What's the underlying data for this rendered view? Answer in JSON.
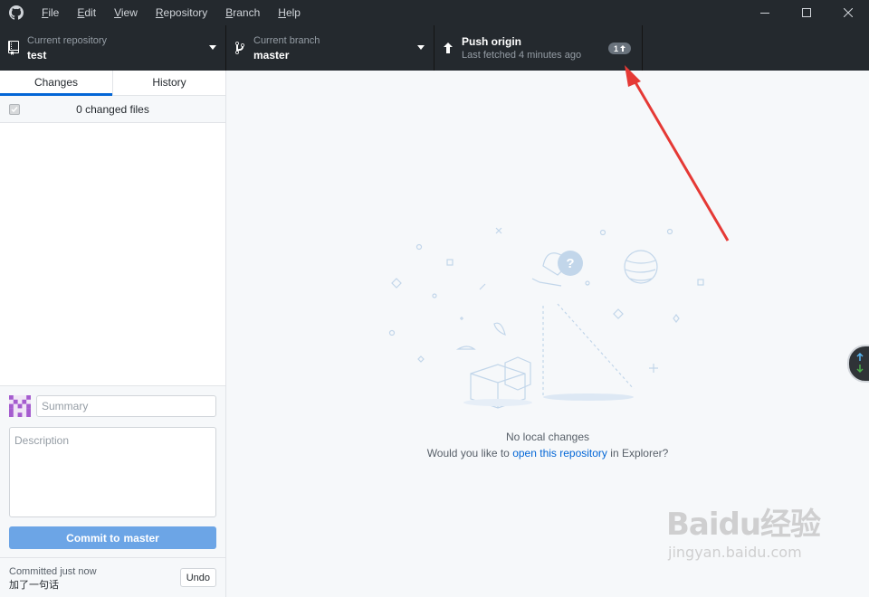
{
  "menu": {
    "items": [
      {
        "prefix": "",
        "ul": "F",
        "rest": "ile"
      },
      {
        "prefix": "",
        "ul": "E",
        "rest": "dit"
      },
      {
        "prefix": "",
        "ul": "V",
        "rest": "iew"
      },
      {
        "prefix": "",
        "ul": "R",
        "rest": "epository"
      },
      {
        "prefix": "",
        "ul": "B",
        "rest": "ranch"
      },
      {
        "prefix": "",
        "ul": "H",
        "rest": "elp"
      }
    ]
  },
  "toolbar": {
    "repo_label": "Current repository",
    "repo_value": "test",
    "branch_label": "Current branch",
    "branch_value": "master",
    "push_label": "Push origin",
    "push_sub": "Last fetched 4 minutes ago",
    "ahead_count": "1"
  },
  "sidebar": {
    "tabs": [
      "Changes",
      "History"
    ],
    "changed_files": "0 changed files",
    "summary_placeholder": "Summary",
    "description_placeholder": "Description",
    "commit_prefix": "Commit to",
    "commit_branch": "master",
    "undo_status": "Committed just now",
    "undo_message": "加了一句话",
    "undo_label": "Undo"
  },
  "main": {
    "title": "No local changes",
    "sub_prefix": "Would you like to",
    "sub_link": "open this repository",
    "sub_suffix": "in Explorer?"
  },
  "watermark": {
    "brand": "Baidu经验",
    "url": "jingyan.baidu.com"
  },
  "colors": {
    "chrome": "#24292e",
    "accent": "#0366d6",
    "commit_button": "#6ca5e6",
    "annotation": "#e53935"
  }
}
